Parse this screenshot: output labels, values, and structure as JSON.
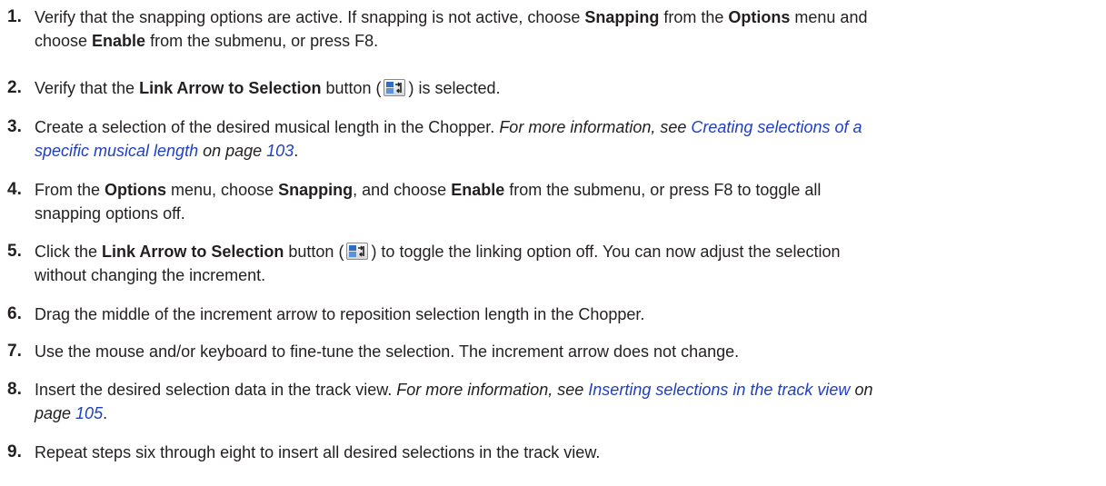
{
  "steps": [
    {
      "number": "1.",
      "l1a": "Verify that the snapping options are active. If snapping is not active, choose ",
      "l1b": "Snapping",
      "l1c": " from the ",
      "l1d": "Options",
      "l1e": " menu and",
      "l2a": "choose ",
      "l2b": "Enable",
      "l2c": " from the submenu, or press F8."
    },
    {
      "number": "2.",
      "l1a": "Verify that the ",
      "l1b": "Link Arrow to Selection",
      "l1c": " button (",
      "icon": "link-arrow-to-selection-icon",
      "l1d": ") is selected."
    },
    {
      "number": "3.",
      "l1a": "Create a selection of the desired musical length in the Chopper. ",
      "ref1": "For more information, see ",
      "link1": "Creating selections of a",
      "link2": "specific musical length",
      "ref2": " on page ",
      "page": "103",
      "end": "."
    },
    {
      "number": "4.",
      "l1a": "From the ",
      "l1b": "Options",
      "l1c": " menu, choose ",
      "l1d": "Snapping",
      "l1e": ", and choose ",
      "l1f": "Enable",
      "l1g": " from the submenu, or press F8 to toggle all",
      "l2": "snapping options off."
    },
    {
      "number": "5.",
      "l1a": "Click the ",
      "l1b": "Link Arrow to Selection",
      "l1c": " button (",
      "icon": "link-arrow-to-selection-icon",
      "l1d": ") to toggle the linking option off. You can now adjust the selection",
      "l2": "without changing the increment."
    },
    {
      "number": "6.",
      "l1": "Drag the middle of the increment arrow to reposition selection length in the Chopper."
    },
    {
      "number": "7.",
      "l1": "Use the mouse and/or keyboard to fine-tune the selection. The increment arrow does not change."
    },
    {
      "number": "8.",
      "l1a": "Insert the desired selection data in the track view. ",
      "ref1": "For more information, see ",
      "link": "Inserting selections in the track view",
      "ref2": " on",
      "ref3": "page ",
      "page": "105",
      "end": "."
    },
    {
      "number": "9.",
      "l1": "Repeat steps six through eight to insert all desired selections in the track view."
    }
  ],
  "colors": {
    "text": "#231f20",
    "link": "#1f3fbf"
  }
}
